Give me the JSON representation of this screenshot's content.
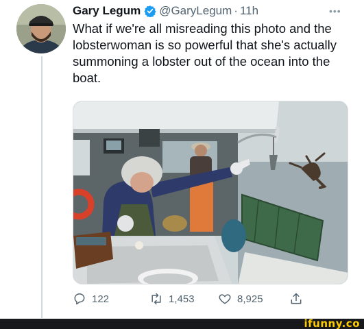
{
  "tweet": {
    "author_name": "Gary Legum",
    "handle": "@GaryLegum",
    "separator": "·",
    "time": "11h",
    "more": "•••",
    "text": "What if we're all misreading this photo and the lobsterwoman is so powerful that she's actually summoning a lobster out of the ocean into the boat.",
    "replies": "122",
    "retweets": "1,453",
    "likes": "8,925"
  },
  "footer": {
    "brand": "ifunny.co"
  },
  "colors": {
    "verified": "#1d9bf0",
    "brand": "#ffcc00",
    "muted": "#536471"
  },
  "icons": {
    "verified": "verified-badge-icon",
    "reply": "reply-icon",
    "retweet": "retweet-icon",
    "like": "heart-icon",
    "share": "share-icon"
  }
}
